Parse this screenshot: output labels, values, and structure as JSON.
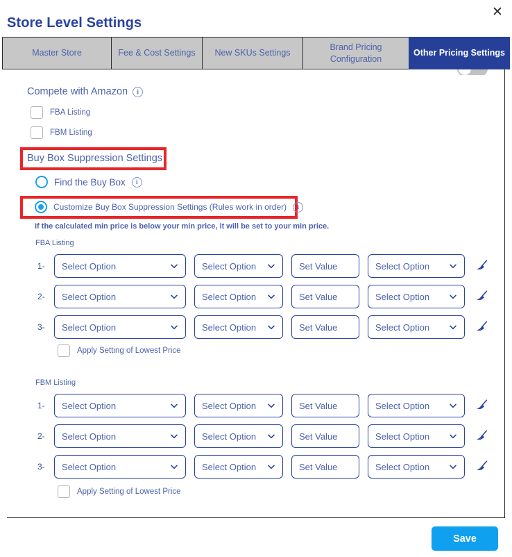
{
  "window": {
    "title": "Store Level Settings",
    "close_label": "✕"
  },
  "tabs": [
    {
      "label": "Master Store",
      "active": false
    },
    {
      "label": "Fee & Cost Settings",
      "active": false
    },
    {
      "label": "New SKUs Settings",
      "active": false
    },
    {
      "label": "Brand Pricing Configuration",
      "active": false
    },
    {
      "label": "Other Pricing Settings",
      "active": true
    }
  ],
  "compete": {
    "title": "Compete with Amazon",
    "info": "i",
    "options": [
      {
        "label": "FBA Listing",
        "checked": false
      },
      {
        "label": "FBM Listing",
        "checked": false
      }
    ]
  },
  "suppression": {
    "heading": "Buy Box Suppression Settings",
    "mode_options": [
      {
        "label": "Find the Buy Box",
        "selected": false,
        "info": "i"
      },
      {
        "label": "Customize Buy Box Suppression Settings (Rules work in order)",
        "selected": true,
        "info": "i"
      }
    ],
    "hint": "If the calculated min price is below your min price, it will be set to your min price.",
    "groups": [
      {
        "label": "FBA Listing",
        "rows": [
          {
            "index": "1-",
            "condition": "Select Option",
            "operator": "Select Option",
            "value": "Set Value",
            "action": "Select Option",
            "clear_icon": "broom-icon"
          },
          {
            "index": "2-",
            "condition": "Select Option",
            "operator": "Select Option",
            "value": "Set Value",
            "action": "Select Option",
            "clear_icon": "broom-icon"
          },
          {
            "index": "3-",
            "condition": "Select Option",
            "operator": "Select Option",
            "value": "Set Value",
            "action": "Select Option",
            "clear_icon": "broom-icon"
          }
        ],
        "apply_lowest": {
          "label": "Apply Setting of Lowest Price",
          "checked": false
        }
      },
      {
        "label": "FBM Listing",
        "rows": [
          {
            "index": "1-",
            "condition": "Select Option",
            "operator": "Select Option",
            "value": "Set Value",
            "action": "Select Option",
            "clear_icon": "broom-icon"
          },
          {
            "index": "2-",
            "condition": "Select Option",
            "operator": "Select Option",
            "value": "Set Value",
            "action": "Select Option",
            "clear_icon": "broom-icon"
          },
          {
            "index": "3-",
            "condition": "Select Option",
            "operator": "Select Option",
            "value": "Set Value",
            "action": "Select Option",
            "clear_icon": "broom-icon"
          }
        ],
        "apply_lowest": {
          "label": "Apply Setting of Lowest Price",
          "checked": false
        }
      }
    ]
  },
  "footer": {
    "save_label": "Save"
  },
  "colors": {
    "accent_dark_blue": "#26409a",
    "accent_bright_blue": "#0fa0f0",
    "text_blue": "#4d62ab",
    "annotation_red": "#e8262a",
    "tab_inactive_bg": "#c7c7c7"
  }
}
